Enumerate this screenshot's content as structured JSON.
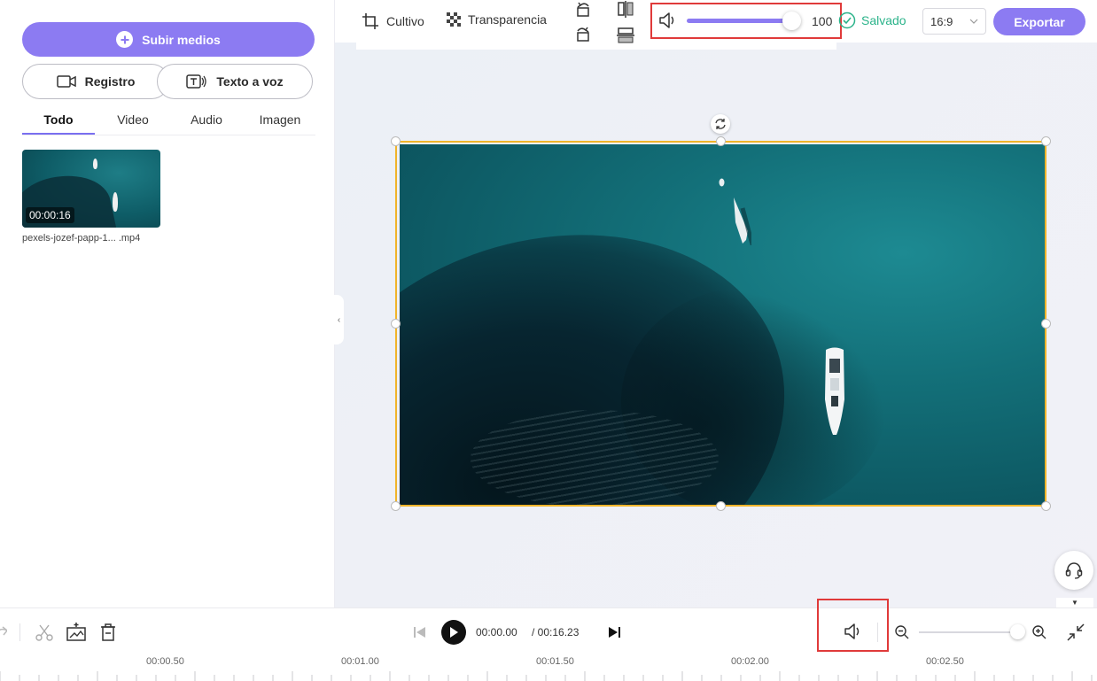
{
  "left_panel": {
    "upload_label": "Subir medios",
    "record_label": "Registro",
    "tts_label": "Texto a voz",
    "tabs": [
      {
        "label": "Todo",
        "active": true
      },
      {
        "label": "Video",
        "active": false
      },
      {
        "label": "Audio",
        "active": false
      },
      {
        "label": "Imagen",
        "active": false
      }
    ],
    "media": [
      {
        "duration": "00:00:16",
        "name": "pexels-jozef-papp-1... .mp4"
      }
    ]
  },
  "toolbar": {
    "crop_label": "Cultivo",
    "transparency_label": "Transparencia",
    "volume_value": "100",
    "volume_level": 1.0,
    "saved_label": "Salvado",
    "aspect_ratio": "16:9",
    "export_label": "Exportar"
  },
  "playback": {
    "current_time": "00:00.00",
    "total_time": "/ 00:16.23"
  },
  "timeline": {
    "ruler_labels": [
      "00:00.50",
      "00:01.00",
      "00:01.50",
      "00:02.00",
      "00:02.50"
    ]
  },
  "colors": {
    "accent": "#8c7bf2",
    "selection": "#f0b42a",
    "highlight_box": "#e03a3a",
    "saved": "#2bb38a"
  },
  "icons": {
    "crop": "crop-icon",
    "transparency": "checker-icon",
    "volume": "speaker-icon",
    "saved": "check-circle-icon",
    "support": "headset-icon"
  }
}
